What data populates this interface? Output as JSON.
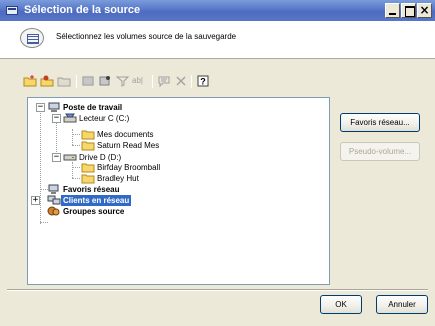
{
  "window": {
    "title": "Sélection de la source"
  },
  "header": {
    "instruction": "Sélectionnez les volumes source de la sauvegarde"
  },
  "toolbar": {
    "icons": [
      "folder-new-icon",
      "user-folder-icon",
      "folder-flat-icon",
      "view-icon",
      "properties-icon",
      "filter-icon",
      "rename-icon",
      "comment-icon",
      "delete-icon",
      "help-icon"
    ]
  },
  "tree": {
    "root": "Poste de travail",
    "drive_c": "Lecteur C (C:)",
    "mes_documents": "Mes documents",
    "saturn": "Saturn Read Mes",
    "drive_d": "Drive D (D:)",
    "birfday": "Birfday Broomball",
    "bradley": "Bradley Hut",
    "favoris": "Favoris réseau",
    "clients": "Clients en réseau",
    "groupes": "Groupes source"
  },
  "buttons": {
    "favoris": "Favoris réseau...",
    "pseudo": "Pseudo-volume...",
    "ok": "OK",
    "annuler": "Annuler"
  }
}
